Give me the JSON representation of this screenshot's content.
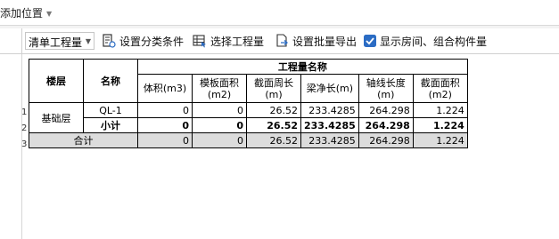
{
  "topbar": {
    "add_position_label": "添加位置"
  },
  "toolbar": {
    "list_select_value": "清单工程量",
    "set_category_label": "设置分类条件",
    "select_quantity_label": "选择工程量",
    "batch_export_label": "设置批量导出",
    "show_rooms_label": "显示房间、组合构件量",
    "show_rooms_checked": true
  },
  "table": {
    "header": {
      "floor": "楼层",
      "name": "名称",
      "group": "工程量名称",
      "columns": [
        "体积(m3)",
        "模板面积(m2)",
        "截面周长(m)",
        "梁净长(m)",
        "轴线长度(m)",
        "截面面积(m2)"
      ]
    },
    "row_numbers": [
      "1",
      "2",
      "3"
    ],
    "floor_value": "基础层",
    "rows": [
      {
        "name": "QL-1",
        "values": [
          "0",
          "0",
          "26.52",
          "233.4285",
          "264.298",
          "1.224"
        ]
      },
      {
        "name": "小计",
        "values": [
          "0",
          "0",
          "26.52",
          "233.4285",
          "264.298",
          "1.224"
        ]
      }
    ],
    "total": {
      "label": "合计",
      "values": [
        "0",
        "0",
        "26.52",
        "233.4285",
        "264.298",
        "1.224"
      ]
    }
  },
  "colors": {
    "checkbox_accent": "#2b6cc4",
    "total_row_bg": "#dcdcdc"
  }
}
